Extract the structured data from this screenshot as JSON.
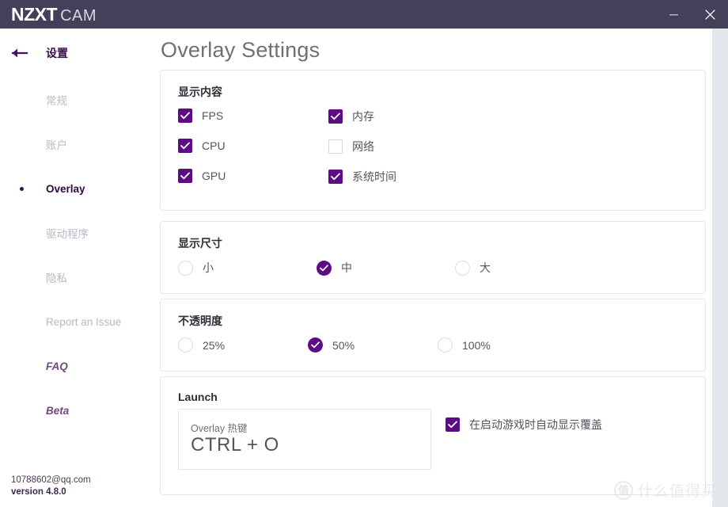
{
  "window": {
    "brand_primary": "NZXT",
    "brand_secondary": "CAM",
    "minimize_label": "−",
    "close_label": "✕",
    "titlebar_color": "#434159"
  },
  "sidebar": {
    "back_label": "设置",
    "items": [
      {
        "label": "常规",
        "active": false,
        "italic": false
      },
      {
        "label": "账户",
        "active": false,
        "italic": false
      },
      {
        "label": "Overlay",
        "active": true,
        "italic": false
      },
      {
        "label": "驱动程序",
        "active": false,
        "italic": false
      },
      {
        "label": "隐私",
        "active": false,
        "italic": false
      },
      {
        "label": "Report an Issue",
        "active": false,
        "italic": false
      },
      {
        "label": "FAQ",
        "active": false,
        "italic": true
      },
      {
        "label": "Beta",
        "active": false,
        "italic": true
      }
    ],
    "account_email": "10788602@qq.com",
    "version": "version 4.8.0"
  },
  "main": {
    "page_title": "Overlay Settings",
    "accent_color": "#5c0d86",
    "display_content": {
      "title": "显示内容",
      "options": [
        {
          "label": "FPS",
          "checked": true
        },
        {
          "label": "CPU",
          "checked": true
        },
        {
          "label": "GPU",
          "checked": true
        },
        {
          "label": "内存",
          "checked": true
        },
        {
          "label": "网络",
          "checked": false
        },
        {
          "label": "系统时间",
          "checked": true
        }
      ]
    },
    "display_size": {
      "title": "显示尺寸",
      "options": [
        {
          "label": "小",
          "selected": false
        },
        {
          "label": "中",
          "selected": true
        },
        {
          "label": "大",
          "selected": false
        }
      ]
    },
    "opacity": {
      "title": "不透明度",
      "options": [
        {
          "label": "25%",
          "selected": false
        },
        {
          "label": "50%",
          "selected": true
        },
        {
          "label": "100%",
          "selected": false
        }
      ]
    },
    "launch": {
      "title": "Launch",
      "hotkey_caption": "Overlay 热键",
      "hotkey_value": "CTRL + O",
      "auto_show": {
        "label": "在启动游戏时自动显示覆盖",
        "checked": true
      }
    }
  },
  "watermark": {
    "mark": "值",
    "text": "什么值得买"
  }
}
